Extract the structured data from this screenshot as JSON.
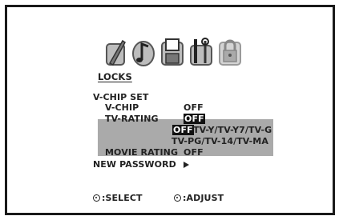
{
  "icons": [
    "picture-icon",
    "sound-icon",
    "setup-icon",
    "tools-icon",
    "locks-icon"
  ],
  "menu": {
    "title": "LOCKS",
    "section": "V-CHIP SET",
    "vchip": {
      "label": "V-CHIP",
      "value": "OFF"
    },
    "tvrating": {
      "label": "TV-RATING",
      "value": "OFF",
      "sub_value": "OFF",
      "sub_line1": "TV-Y/TV-Y7/TV-G",
      "sub_line2": "TV-PG/TV-14/TV-MA"
    },
    "movie": {
      "label": "MOVIE RATING",
      "value": "OFF"
    },
    "password": {
      "label": "NEW PASSWORD"
    }
  },
  "footer": {
    "select": ":SELECT",
    "adjust": ":ADJUST"
  },
  "colors": {
    "highlight": "#aaaaaa",
    "inverse_bg": "#111111",
    "text": "#222222"
  }
}
